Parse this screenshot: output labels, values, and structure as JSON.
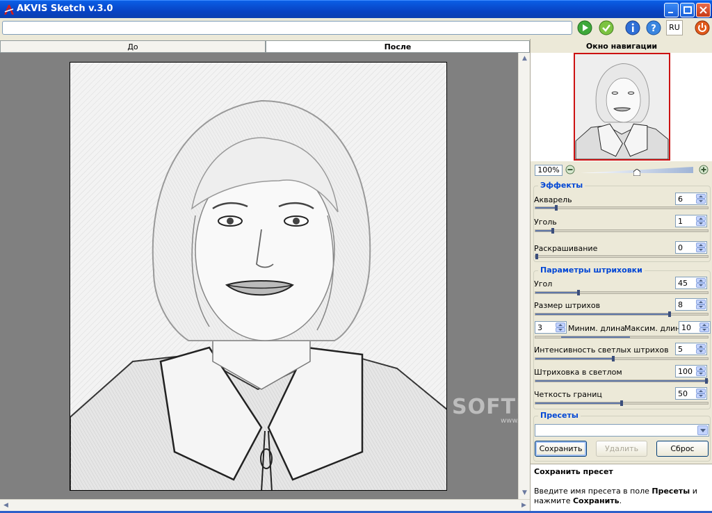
{
  "app": {
    "title": "AKVIS Sketch v.3.0"
  },
  "toolbar": {
    "path_value": "",
    "lang": "RU",
    "icons": [
      "play-icon",
      "apply-icon",
      "info-icon",
      "help-icon",
      "power-icon"
    ]
  },
  "tabs": {
    "before": "До",
    "after": "После"
  },
  "navigator": {
    "title": "Окно навигации",
    "zoom": "100%"
  },
  "effects": {
    "title": "Эффекты",
    "params": [
      {
        "label": "Акварель",
        "value": "6",
        "level": 0.12
      },
      {
        "label": "Уголь",
        "value": "1",
        "level": 0.1
      },
      {
        "label": "Раскрашивание",
        "value": "0",
        "level": 0.0
      }
    ]
  },
  "hatching": {
    "title": "Параметры штриховки",
    "angle": {
      "label": "Угол",
      "value": "45",
      "level": 0.25
    },
    "stroke_size": {
      "label": "Размер штрихов",
      "value": "8",
      "level": 0.78
    },
    "min_len": {
      "label": "Миним. длина",
      "value": "3"
    },
    "max_len": {
      "label": "Максим. длина",
      "value": "10"
    },
    "light_intensity": {
      "label": "Интенсивность светлых штрихов",
      "value": "5",
      "level": 0.45
    },
    "light_hatch": {
      "label": "Штриховка в светлом",
      "value": "100",
      "level": 1.0
    },
    "edge_sharpness": {
      "label": "Четкость границ",
      "value": "50",
      "level": 0.5
    }
  },
  "presets": {
    "title": "Пресеты",
    "selected": "",
    "save": "Сохранить",
    "delete": "Удалить",
    "reset": "Сброс"
  },
  "help": {
    "title": "Сохранить пресет",
    "t1": "Введите имя пресета в поле ",
    "b1": "Пресеты",
    "t2": " и нажмите ",
    "b2": "Сохранить",
    "t3": "."
  },
  "watermark": {
    "text": "SOFTPORTAL",
    "url": "www.softportal.com"
  },
  "colors": {
    "titlebar": "#0a5fe6",
    "accent": "#0046d5",
    "panel": "#ece9d8",
    "workspace": "#808080"
  }
}
